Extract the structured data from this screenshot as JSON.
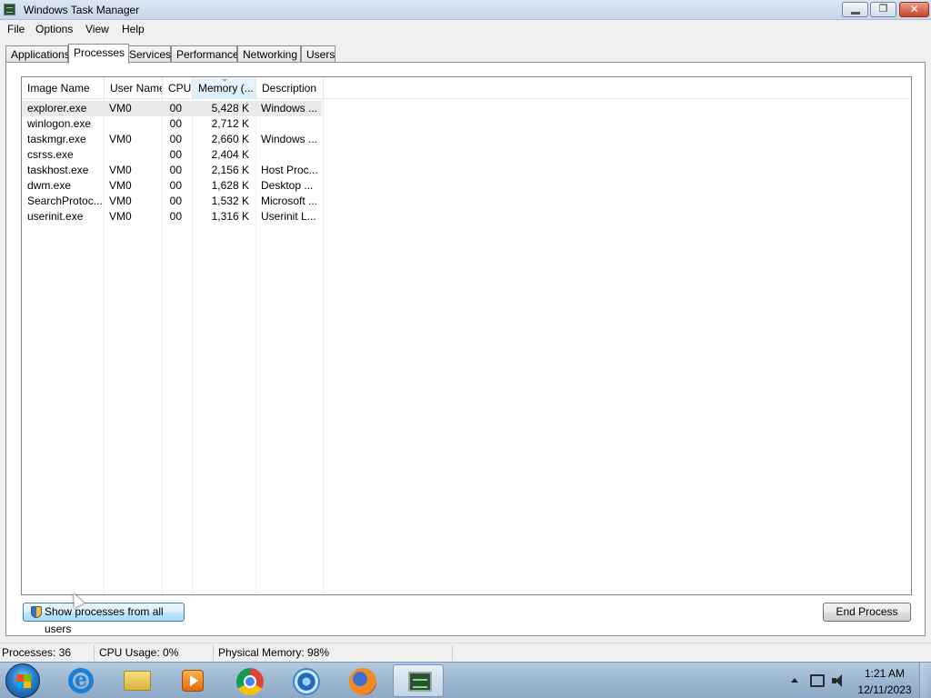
{
  "window": {
    "title": "Windows Task Manager",
    "minimize_label": "",
    "maximize_label": "❐",
    "close_label": "✕"
  },
  "menu": [
    "File",
    "Options",
    "View",
    "Help"
  ],
  "tabs": [
    "Applications",
    "Processes",
    "Services",
    "Performance",
    "Networking",
    "Users"
  ],
  "active_tab": "Processes",
  "table": {
    "columns": [
      "Image Name",
      "User Name",
      "CPU",
      "Memory (...",
      "Description"
    ],
    "sorted_column": "Memory (...",
    "rows": [
      {
        "name": "explorer.exe",
        "user": "VM0",
        "cpu": "00",
        "mem": "5,428 K",
        "desc": "Windows ..."
      },
      {
        "name": "winlogon.exe",
        "user": "",
        "cpu": "00",
        "mem": "2,712 K",
        "desc": ""
      },
      {
        "name": "taskmgr.exe",
        "user": "VM0",
        "cpu": "00",
        "mem": "2,660 K",
        "desc": "Windows ..."
      },
      {
        "name": "csrss.exe",
        "user": "",
        "cpu": "00",
        "mem": "2,404 K",
        "desc": ""
      },
      {
        "name": "taskhost.exe",
        "user": "VM0",
        "cpu": "00",
        "mem": "2,156 K",
        "desc": "Host Proc..."
      },
      {
        "name": "dwm.exe",
        "user": "VM0",
        "cpu": "00",
        "mem": "1,628 K",
        "desc": "Desktop ..."
      },
      {
        "name": "SearchProtoc...",
        "user": "VM0",
        "cpu": "00",
        "mem": "1,532 K",
        "desc": "Microsoft ..."
      },
      {
        "name": "userinit.exe",
        "user": "VM0",
        "cpu": "00",
        "mem": "1,316 K",
        "desc": "Userinit L..."
      }
    ]
  },
  "buttons": {
    "show_all": "Show processes from all users",
    "end_process": "End Process"
  },
  "status": {
    "processes": "Processes: 36",
    "cpu": "CPU Usage: 0%",
    "memory": "Physical Memory: 98%"
  },
  "taskbar": {
    "apps": [
      "start-orb",
      "internet-explorer-icon",
      "folder-icon",
      "media-player-icon",
      "chrome-icon",
      "chrome-browser-icon",
      "firefox-icon",
      "task-manager-icon"
    ],
    "time": "1:21 AM",
    "date": "12/11/2023"
  }
}
